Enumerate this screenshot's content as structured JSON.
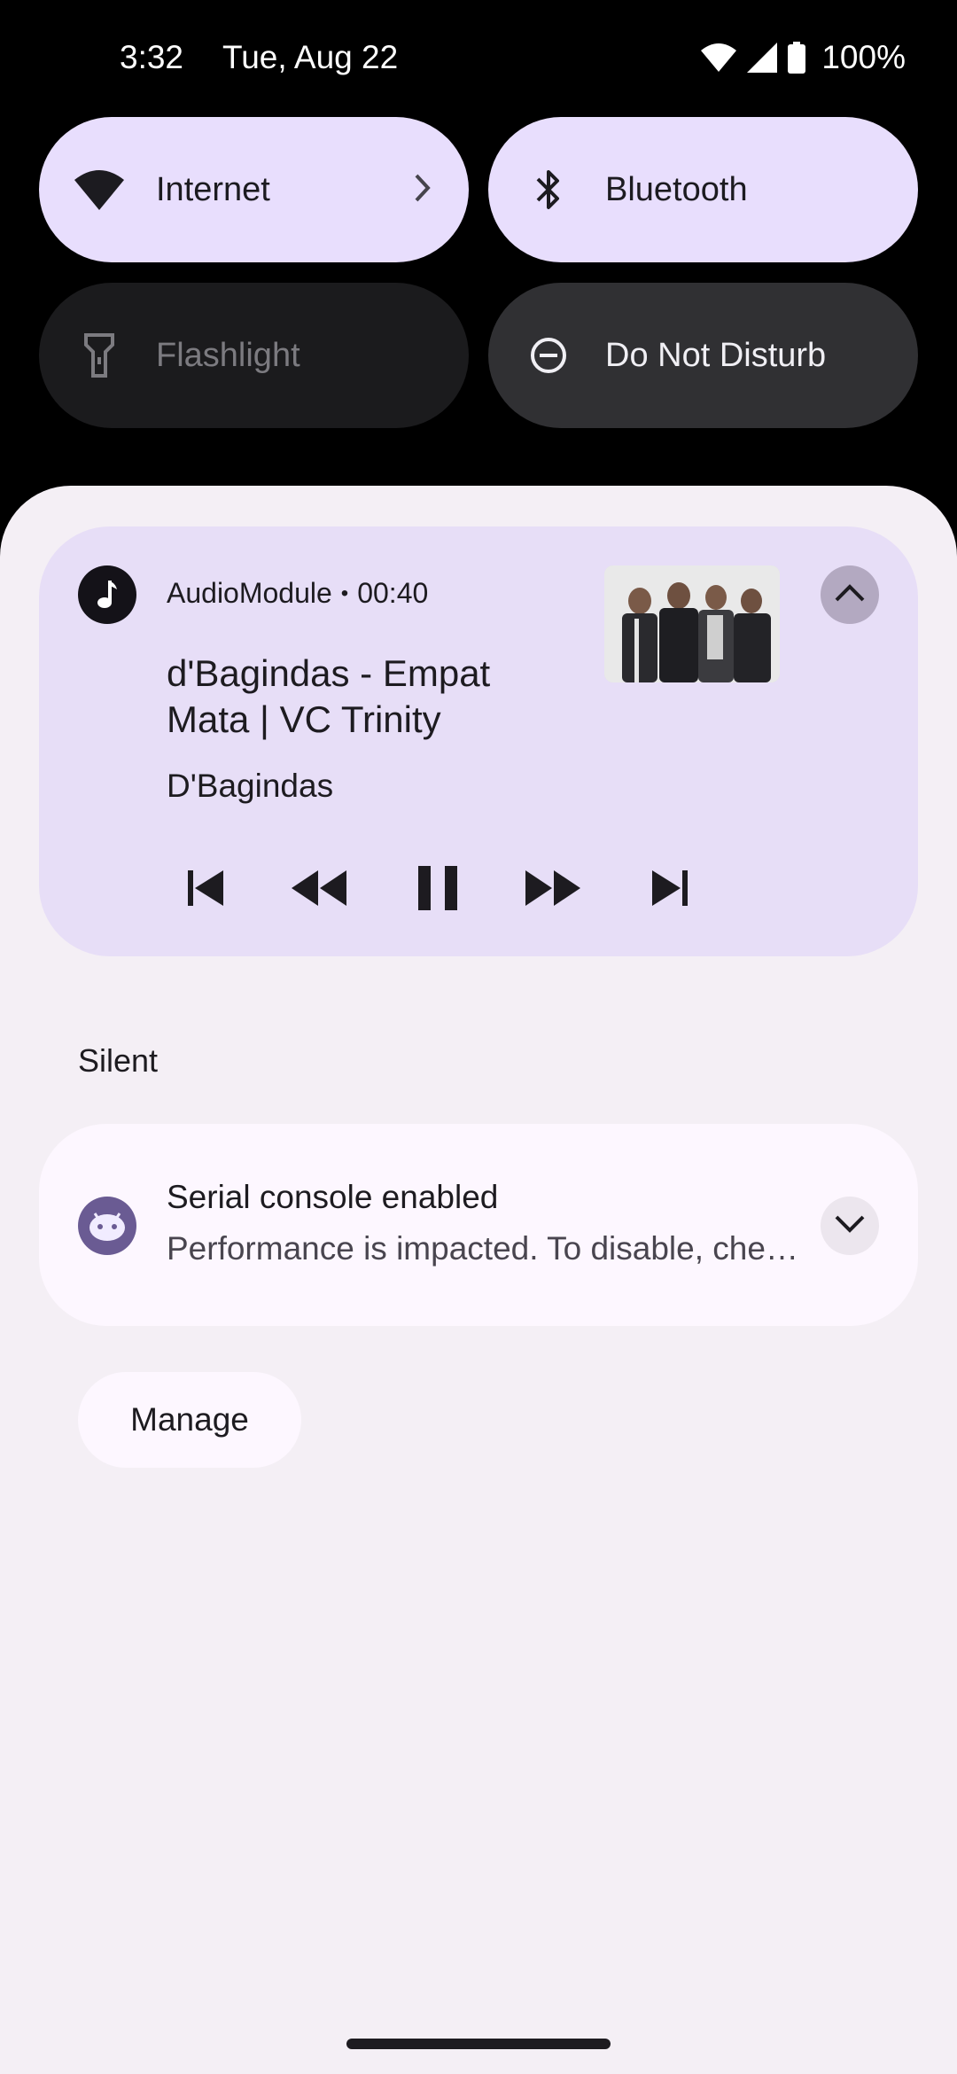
{
  "status_bar": {
    "time": "3:32",
    "date": "Tue, Aug 22",
    "battery": "100%",
    "icons": [
      "wifi-icon",
      "signal-icon",
      "battery-icon"
    ]
  },
  "quick_settings": {
    "tiles": [
      {
        "label": "Internet",
        "icon": "wifi-icon",
        "state": "on",
        "has_chevron": true
      },
      {
        "label": "Bluetooth",
        "icon": "bluetooth-icon",
        "state": "on"
      },
      {
        "label": "Flashlight",
        "icon": "flashlight-icon",
        "state": "off"
      },
      {
        "label": "Do Not Disturb",
        "icon": "dnd-icon",
        "state": "off"
      }
    ]
  },
  "media": {
    "app": "AudioModule",
    "elapsed": "00:40",
    "title": "d'Bagindas - Empat Mata | VC Trinity",
    "artist": "D'Bagindas",
    "controls": [
      "skip-previous-icon",
      "rewind-icon",
      "pause-icon",
      "fast-forward-icon",
      "skip-next-icon"
    ]
  },
  "silent": {
    "section_label": "Silent",
    "notification": {
      "title": "Serial console enabled",
      "body": "Performance is impacted. To disable, check bootloader."
    },
    "manage_label": "Manage"
  },
  "colors": {
    "tile_on": "#e8defd",
    "tile_off": "#1b1b1d",
    "shade_bg": "#f4eff5",
    "media_card": "#e7def7",
    "notif_card": "#fdf7ff",
    "accent": "#6a5b93"
  }
}
